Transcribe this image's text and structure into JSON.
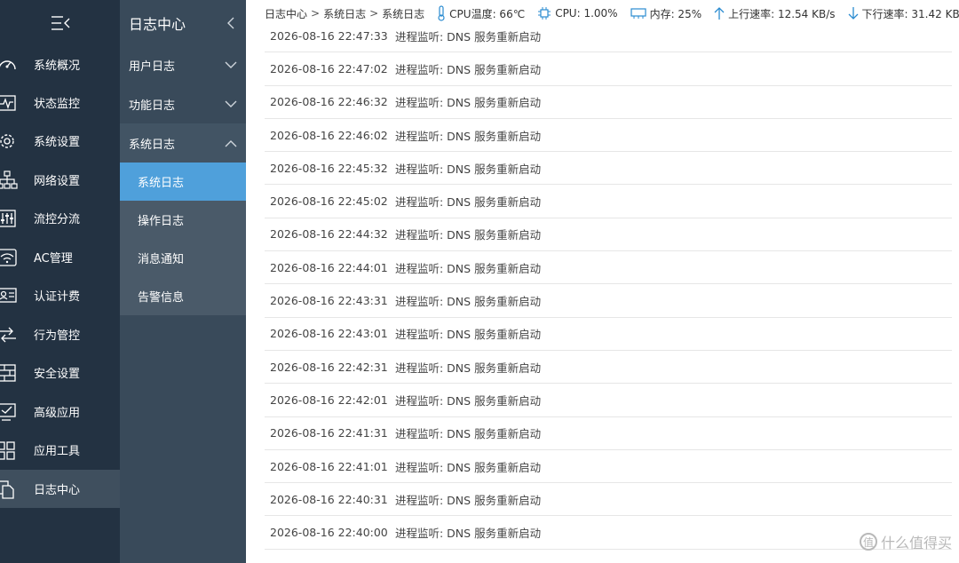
{
  "sidebar": {
    "items": [
      {
        "label": "系统概况",
        "icon": "dashboard-icon"
      },
      {
        "label": "状态监控",
        "icon": "pulse-icon"
      },
      {
        "label": "系统设置",
        "icon": "gear-icon"
      },
      {
        "label": "网络设置",
        "icon": "network-icon"
      },
      {
        "label": "流控分流",
        "icon": "sliders-icon"
      },
      {
        "label": "AC管理",
        "icon": "wifi-icon"
      },
      {
        "label": "认证计费",
        "icon": "id-card-icon"
      },
      {
        "label": "行为管控",
        "icon": "arrows-icon"
      },
      {
        "label": "安全设置",
        "icon": "firewall-icon"
      },
      {
        "label": "高级应用",
        "icon": "check-screen-icon"
      },
      {
        "label": "应用工具",
        "icon": "grid-icon"
      },
      {
        "label": "日志中心",
        "icon": "documents-icon"
      }
    ]
  },
  "subnav": {
    "title": "日志中心",
    "groups": [
      {
        "label": "用户日志"
      },
      {
        "label": "功能日志"
      },
      {
        "label": "系统日志"
      }
    ],
    "children": [
      {
        "label": "系统日志"
      },
      {
        "label": "操作日志"
      },
      {
        "label": "消息通知"
      },
      {
        "label": "告警信息"
      }
    ]
  },
  "topbar": {
    "breadcrumb": [
      "日志中心",
      "系统日志",
      "系统日志"
    ],
    "cpu_temp": "CPU温度: 66℃",
    "cpu": "CPU: 1.00%",
    "memory": "内存: 25%",
    "upload": "上行速率: 12.54 KB/s",
    "download": "下行速率: 31.42 KB/s"
  },
  "log": {
    "rows": [
      {
        "time": "2026-08-16 22:47:33",
        "msg": "进程监听: DNS 服务重新启动"
      },
      {
        "time": "2026-08-16 22:47:02",
        "msg": "进程监听: DNS 服务重新启动"
      },
      {
        "time": "2026-08-16 22:46:32",
        "msg": "进程监听: DNS 服务重新启动"
      },
      {
        "time": "2026-08-16 22:46:02",
        "msg": "进程监听: DNS 服务重新启动"
      },
      {
        "time": "2026-08-16 22:45:32",
        "msg": "进程监听: DNS 服务重新启动"
      },
      {
        "time": "2026-08-16 22:45:02",
        "msg": "进程监听: DNS 服务重新启动"
      },
      {
        "time": "2026-08-16 22:44:32",
        "msg": "进程监听: DNS 服务重新启动"
      },
      {
        "time": "2026-08-16 22:44:01",
        "msg": "进程监听: DNS 服务重新启动"
      },
      {
        "time": "2026-08-16 22:43:31",
        "msg": "进程监听: DNS 服务重新启动"
      },
      {
        "time": "2026-08-16 22:43:01",
        "msg": "进程监听: DNS 服务重新启动"
      },
      {
        "time": "2026-08-16 22:42:31",
        "msg": "进程监听: DNS 服务重新启动"
      },
      {
        "time": "2026-08-16 22:42:01",
        "msg": "进程监听: DNS 服务重新启动"
      },
      {
        "time": "2026-08-16 22:41:31",
        "msg": "进程监听: DNS 服务重新启动"
      },
      {
        "time": "2026-08-16 22:41:01",
        "msg": "进程监听: DNS 服务重新启动"
      },
      {
        "time": "2026-08-16 22:40:31",
        "msg": "进程监听: DNS 服务重新启动"
      },
      {
        "time": "2026-08-16 22:40:00",
        "msg": "进程监听: DNS 服务重新启动"
      }
    ]
  },
  "watermark": {
    "glyph": "值",
    "text": "什么值得买"
  },
  "colors": {
    "sidebar_bg": "#233242",
    "subnav_bg": "#394a5a",
    "selected": "#4fa0db"
  }
}
